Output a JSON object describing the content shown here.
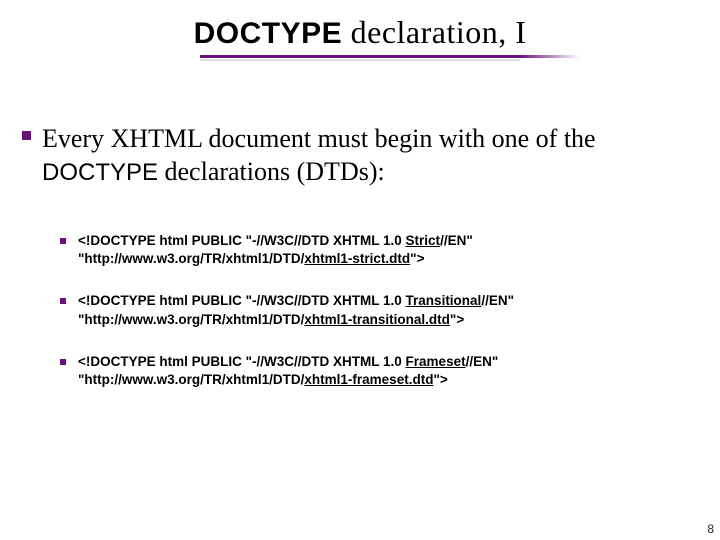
{
  "title": {
    "word_doctype": "DOCTYPE",
    "rest": " declaration, I"
  },
  "main": {
    "prefix": "Every XHTML document must begin with one of the ",
    "word_doctype": "DOCTYPE",
    "suffix": " declarations (DTDs):"
  },
  "subitems": [
    {
      "p1a": "<!DOCTYPE html PUBLIC \"-//W3C//DTD XHTML 1.0 ",
      "p1u": "Strict",
      "p1b": "//EN\"",
      "p2a": "\"http://www.w3.org/TR/xhtml1/DTD/",
      "p2u": "xhtml1-strict.dtd",
      "p2b": "\">"
    },
    {
      "p1a": "<!DOCTYPE html PUBLIC \"-//W3C//DTD XHTML 1.0 ",
      "p1u": "Transitional",
      "p1b": "//EN\"",
      "p2a": "\"http://www.w3.org/TR/xhtml1/DTD/",
      "p2u": "xhtml1-transitional.dtd",
      "p2b": "\">"
    },
    {
      "p1a": "<!DOCTYPE html PUBLIC \"-//W3C//DTD XHTML 1.0 ",
      "p1u": "Frameset",
      "p1b": "//EN\"",
      "p2a": "\"http://www.w3.org/TR/xhtml1/DTD/",
      "p2u": "xhtml1-frameset.dtd",
      "p2b": "\">"
    }
  ],
  "page_number": "8"
}
